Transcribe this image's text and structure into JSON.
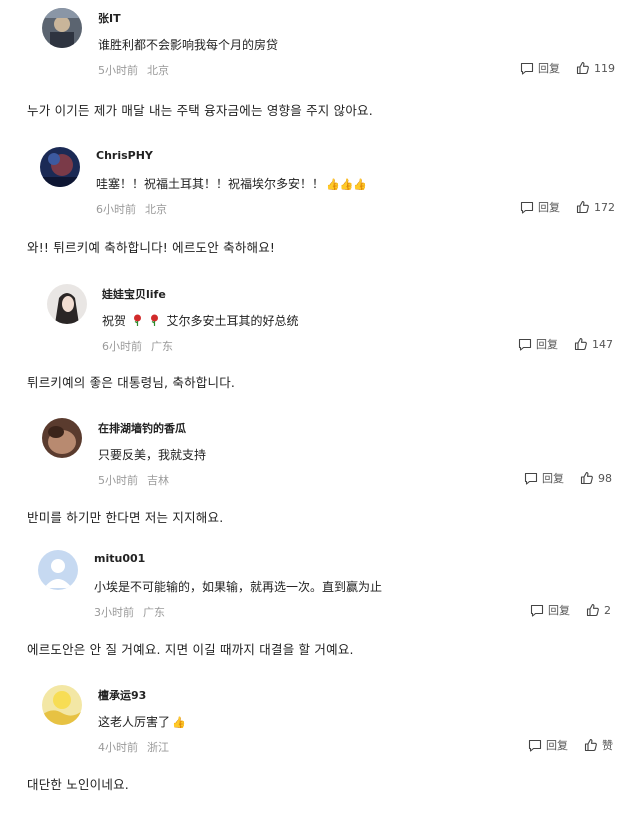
{
  "comments": [
    {
      "username": "张IT",
      "text": "谁胜利都不会影响我每个月的房贷",
      "time": "5小时前",
      "location": "北京",
      "reply_label": "回复",
      "likes": "119",
      "translation": "누가 이기든 제가 매달 내는 주택 융자금에는 영향을 주지 않아요."
    },
    {
      "username": "ChrisPHY",
      "text": "哇塞！！祝福土耳其！！祝福埃尔多安！！",
      "emoji": "👍👍👍",
      "time": "6小时前",
      "location": "北京",
      "reply_label": "回复",
      "likes": "172",
      "translation": "와!! 튀르키예 축하합니다! 에르도안 축하해요!"
    },
    {
      "username": "娃娃宝贝life",
      "text_prefix": "祝贺",
      "text": "艾尔多安土耳其的好总统",
      "time": "6小时前",
      "location": "广东",
      "reply_label": "回复",
      "likes": "147",
      "translation": "튀르키예의 좋은 대통령님, 축하합니다."
    },
    {
      "username": "在排湖墙钓的香瓜",
      "text": "只要反美，我就支持",
      "time": "5小时前",
      "location": "吉林",
      "reply_label": "回复",
      "likes": "98",
      "translation": "반미를 하기만 한다면 저는 지지해요."
    },
    {
      "username": "mitu001",
      "text": "小埃是不可能输的，如果输，就再选一次。直到赢为止",
      "time": "3小时前",
      "location": "广东",
      "reply_label": "回复",
      "likes": "2",
      "translation": "에르도안은 안 질 거예요. 지면 이길 때까지 대결을 할 거예요."
    },
    {
      "username": "檀承运93",
      "text": "这老人厉害了",
      "emoji": "👍",
      "time": "4小时前",
      "location": "浙江",
      "reply_label": "回复",
      "likes": "赞",
      "translation": "대단한 노인이네요."
    }
  ]
}
